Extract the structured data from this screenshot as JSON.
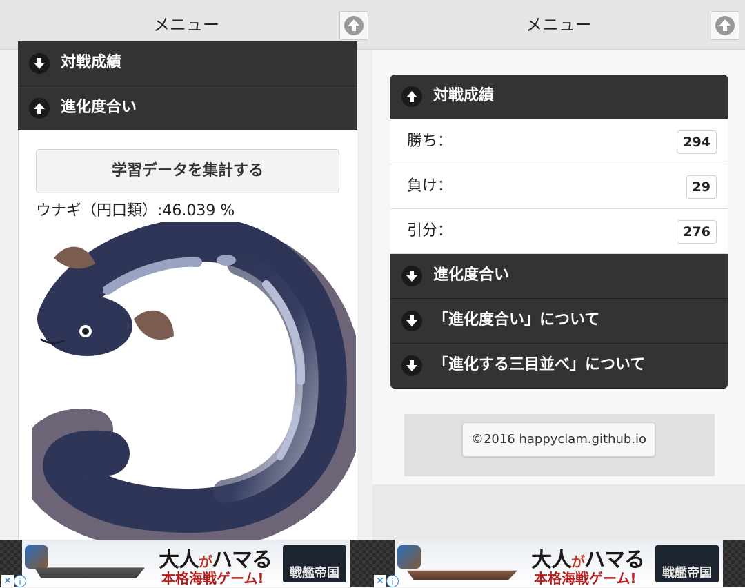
{
  "left": {
    "header": {
      "title": "メニュー"
    },
    "accordion": [
      {
        "label": "対戦成績",
        "icon": "arrow-down-icon"
      },
      {
        "label": "進化度合い",
        "icon": "arrow-up-icon"
      }
    ],
    "learn_button": "学習データを集計する",
    "result_text": "ウナギ（円口類）:46.039 %",
    "image": {
      "subject": "eel-illustration"
    }
  },
  "right": {
    "header": {
      "title": "メニュー"
    },
    "stats_header": {
      "label": "対戦成績",
      "icon": "arrow-up-icon"
    },
    "stats": [
      {
        "label": "勝ち：",
        "value": "294"
      },
      {
        "label": "負け：",
        "value": "29"
      },
      {
        "label": "引分：",
        "value": "276"
      }
    ],
    "accordion": [
      {
        "label": "進化度合い",
        "icon": "arrow-down-icon"
      },
      {
        "label": "「進化度合い」について",
        "icon": "arrow-down-icon"
      },
      {
        "label": "「進化する三目並べ」について",
        "icon": "arrow-down-icon"
      }
    ],
    "copyright": "©2016 happyclam.github.io"
  },
  "ad": {
    "headline_a": "大人",
    "headline_b": "が",
    "headline_c": "ハマる",
    "sub": "本格海戦ゲーム!",
    "brand": "戦艦帝国",
    "close": "✕",
    "info": "i"
  },
  "colors": {
    "bar": "#333333",
    "page": "#f0f0f0",
    "eel_body": "#2e3453",
    "eel_fin": "#7a5c50"
  }
}
